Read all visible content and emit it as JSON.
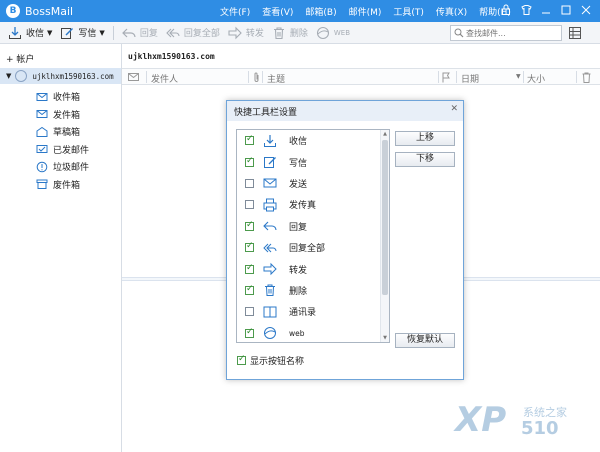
{
  "app": {
    "title": "BossMail"
  },
  "menu": [
    "文件(F)",
    "查看(V)",
    "邮箱(B)",
    "邮件(M)",
    "工具(T)",
    "传真(X)",
    "帮助(H)"
  ],
  "toolbar": {
    "receive": "收信",
    "compose": "写信",
    "reply": "回复",
    "reply_all": "回复全部",
    "forward": "转发",
    "delete": "删除",
    "web": "WEB"
  },
  "search": {
    "placeholder": "查找邮件..."
  },
  "sidebar": {
    "add_account": "+ 帐户",
    "account_name": "ujklhxm1590163.com",
    "folders": [
      "收件箱",
      "发件箱",
      "草稿箱",
      "已发邮件",
      "垃圾邮件",
      "废件箱"
    ]
  },
  "list": {
    "account_label": "ujklhxm1590163.com",
    "columns": {
      "sender": "发件人",
      "subject": "主题",
      "date": "日期",
      "size": "大小"
    }
  },
  "dialog": {
    "title": "快捷工具栏设置",
    "items": [
      {
        "label": "收信",
        "checked": true
      },
      {
        "label": "写信",
        "checked": true
      },
      {
        "label": "发送",
        "checked": false
      },
      {
        "label": "发传真",
        "checked": false
      },
      {
        "label": "回复",
        "checked": true
      },
      {
        "label": "回复全部",
        "checked": true
      },
      {
        "label": "转发",
        "checked": true
      },
      {
        "label": "删除",
        "checked": true
      },
      {
        "label": "通讯录",
        "checked": false
      },
      {
        "label": "web",
        "checked": true
      }
    ],
    "move_up": "上移",
    "move_down": "下移",
    "restore_default": "恢复默认",
    "show_button_names": "显示按钮名称",
    "show_button_names_checked": true
  },
  "watermark": {
    "big": "XP",
    "small": "系统之家",
    "num": "510"
  },
  "colors": {
    "title_bar": "#2f8de4",
    "accent": "#2f8de4",
    "check": "#2e8b2e"
  }
}
